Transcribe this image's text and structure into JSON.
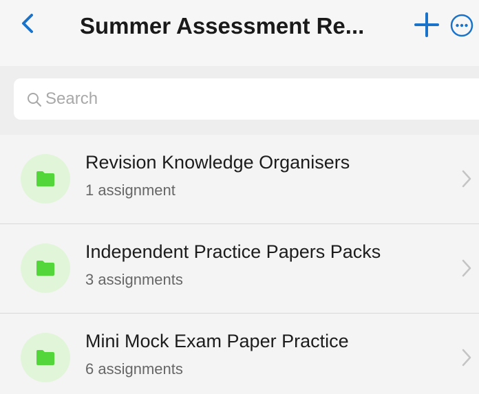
{
  "navbar": {
    "title": "Summer Assessment Re...",
    "back_icon": "chevron-left-icon",
    "add_icon": "plus-icon",
    "more_icon": "ellipsis-circle-icon",
    "accent_color": "#1a73c8"
  },
  "search": {
    "placeholder": "Search",
    "value": "",
    "icon": "search-icon"
  },
  "folders": [
    {
      "title": "Revision Knowledge Organisers",
      "subtitle": "1 assignment",
      "icon": "folder-icon"
    },
    {
      "title": "Independent Practice Papers Packs",
      "subtitle": "3 assignments",
      "icon": "folder-icon"
    },
    {
      "title": "Mini Mock Exam Paper Practice",
      "subtitle": "6 assignments",
      "icon": "folder-icon"
    }
  ],
  "colors": {
    "folder_green": "#52d63a",
    "folder_bg": "#e1f5d9"
  }
}
